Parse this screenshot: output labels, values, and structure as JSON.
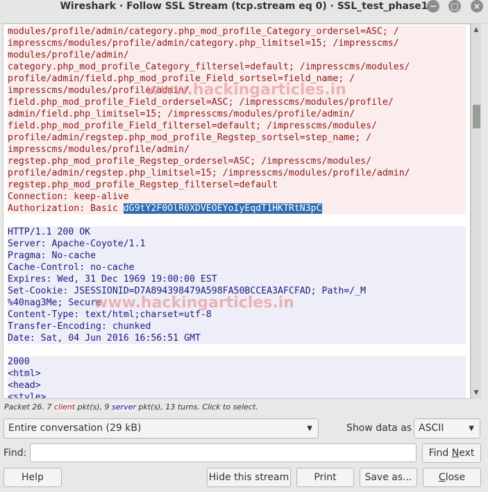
{
  "window": {
    "title": "Wireshark · Follow SSL Stream (tcp.stream eq 0) · SSL_test_phase1",
    "min_glyph": "−",
    "max_glyph": "□",
    "close_glyph": "×"
  },
  "stream": {
    "client_lines": [
      "modules/profile/admin/category.php_mod_profile_Category_ordersel=ASC; /",
      "impresscms/modules/profile/admin/category.php_limitsel=15; /impresscms/",
      "modules/profile/admin/",
      "category.php_mod_profile_Category_filtersel=default; /impresscms/modules/",
      "profile/admin/field.php_mod_profile_Field_sortsel=field_name; /",
      "impresscms/modules/profile/admin/",
      "field.php_mod_profile_Field_ordersel=ASC; /impresscms/modules/profile/",
      "admin/field.php_limitsel=15; /impresscms/modules/profile/admin/",
      "field.php_mod_profile_Field_filtersel=default; /impresscms/modules/",
      "profile/admin/regstep.php_mod_profile_Regstep_sortsel=step_name; /",
      "impresscms/modules/profile/admin/",
      "regstep.php_mod_profile_Regstep_ordersel=ASC; /impresscms/modules/",
      "profile/admin/regstep.php_limitsel=15; /impresscms/modules/profile/admin/",
      "regstep.php_mod_profile_Regstep_filtersel=default",
      "Connection: keep-alive"
    ],
    "auth_prefix": "Authorization: Basic ",
    "auth_value": "dG9tY2F0OlR0XDVEOEYoIyEqdT1HKTRtN3pC",
    "server_lines": [
      "HTTP/1.1 200 OK",
      "Server: Apache-Coyote/1.1",
      "Pragma: No-cache",
      "Cache-Control: no-cache",
      "Expires: Wed, 31 Dec 1969 19:00:00 EST",
      "Set-Cookie: JSESSIONID=D7A894398479A598FA50BCCEA3AFCFAD; Path=/_M",
      "%40nag3Me; Secure",
      "Content-Type: text/html;charset=utf-8",
      "Transfer-Encoding: chunked",
      "Date: Sat, 04 Jun 2016 16:56:51 GMT"
    ],
    "server_lines_2": [
      "2000",
      "<html>",
      "<head>",
      "<style>"
    ],
    "watermark": "www.hackingarticles.in"
  },
  "status": {
    "prefix": "Packet 26. 7 ",
    "client_tag": "client",
    "middle": " pkt(s), 9 ",
    "server_tag": "server",
    "suffix": " pkt(s), 13 turns. Click to select."
  },
  "controls": {
    "conversation_select": "Entire conversation (29 kB)",
    "show_data_as_label": "Show data as",
    "show_data_as_value": "ASCII",
    "find_label": "Find:",
    "find_value": "",
    "find_next_prefix": "Find ",
    "find_next_accel": "N",
    "find_next_suffix": "ext",
    "help": "Help",
    "hide_stream": "Hide this stream",
    "print": "Print",
    "save_as": "Save as...",
    "close_accel": "C",
    "close_suffix": "lose"
  }
}
